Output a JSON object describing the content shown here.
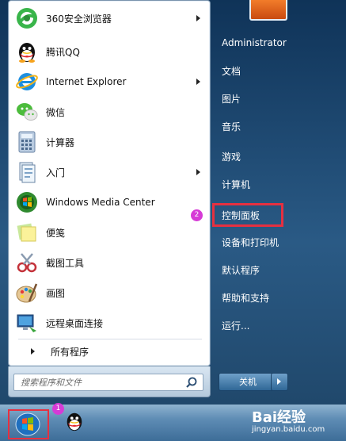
{
  "programs": [
    {
      "label": "360安全浏览器",
      "icon": "360-browser-icon",
      "submenu": true
    },
    {
      "label": "腾讯QQ",
      "icon": "qq-icon",
      "submenu": false
    },
    {
      "label": "Internet Explorer",
      "icon": "internet-explorer-icon",
      "submenu": true
    },
    {
      "label": "微信",
      "icon": "wechat-icon",
      "submenu": false
    },
    {
      "label": "计算器",
      "icon": "calculator-icon",
      "submenu": false
    },
    {
      "label": "入门",
      "icon": "getting-started-icon",
      "submenu": true
    },
    {
      "label": "Windows Media Center",
      "icon": "media-center-icon",
      "submenu": false
    },
    {
      "label": "便笺",
      "icon": "sticky-notes-icon",
      "submenu": false
    },
    {
      "label": "截图工具",
      "icon": "snipping-tool-icon",
      "submenu": false
    },
    {
      "label": "画图",
      "icon": "paint-icon",
      "submenu": false
    },
    {
      "label": "远程桌面连接",
      "icon": "remote-desktop-icon",
      "submenu": false
    }
  ],
  "all_programs": "所有程序",
  "search": {
    "placeholder": "搜索程序和文件",
    "icon": "search-icon"
  },
  "right_links": [
    {
      "label": "Administrator",
      "name": "user-name-link"
    },
    {
      "label": "文档",
      "name": "documents-link"
    },
    {
      "label": "图片",
      "name": "pictures-link"
    },
    {
      "label": "音乐",
      "name": "music-link"
    },
    {
      "label": "游戏",
      "name": "games-link"
    },
    {
      "label": "计算机",
      "name": "computer-link"
    },
    {
      "label": "控制面板",
      "name": "control-panel-link"
    },
    {
      "label": "设备和打印机",
      "name": "devices-printers-link"
    },
    {
      "label": "默认程序",
      "name": "default-programs-link"
    },
    {
      "label": "帮助和支持",
      "name": "help-support-link"
    },
    {
      "label": "运行...",
      "name": "run-link"
    }
  ],
  "shutdown_label": "关机",
  "badges": {
    "start": "1",
    "control_panel": "2"
  },
  "watermark": {
    "line1": "Bai经验",
    "line2": "jingyan.baidu.com"
  },
  "colors": {
    "highlight": "#e63040",
    "badge": "#d63bd6"
  }
}
